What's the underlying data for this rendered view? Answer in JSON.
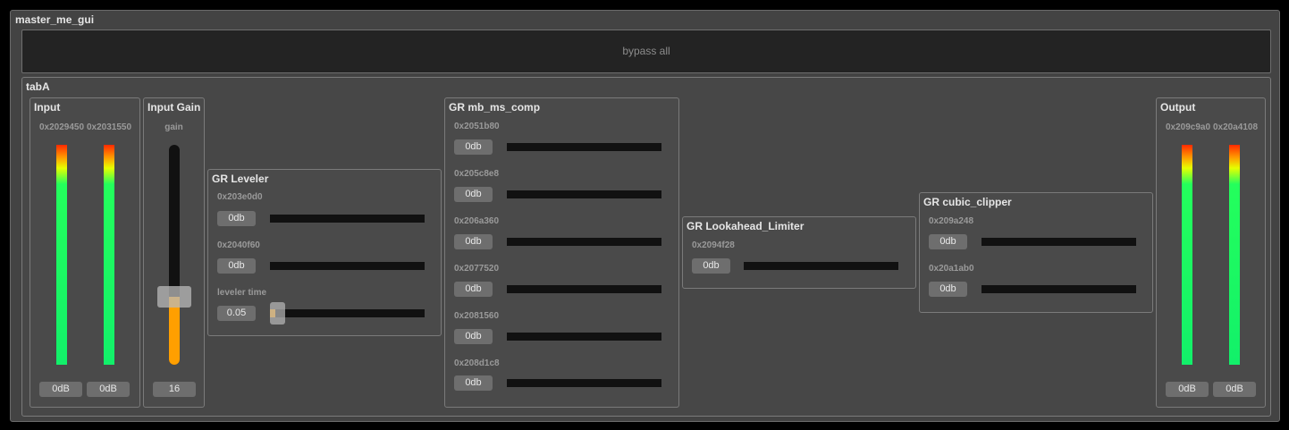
{
  "window": {
    "title": "master_me_gui",
    "bypass_label": "bypass all"
  },
  "tab": {
    "title": "tabA"
  },
  "input": {
    "title": "Input",
    "channels": [
      {
        "id": "0x2029450",
        "value": "0dB"
      },
      {
        "id": "0x2031550",
        "value": "0dB"
      }
    ]
  },
  "input_gain": {
    "title": "Input Gain",
    "label": "gain",
    "value": "16",
    "level": 0.31
  },
  "leveler": {
    "title": "GR Leveler",
    "meters": [
      {
        "id": "0x203e0d0",
        "value": "0db"
      },
      {
        "id": "0x2040f60",
        "value": "0db"
      }
    ],
    "time": {
      "label": "leveler time",
      "value": "0.05",
      "level": 0.03
    }
  },
  "mb_ms_comp": {
    "title": "GR mb_ms_comp",
    "meters": [
      {
        "id": "0x2051b80",
        "value": "0db"
      },
      {
        "id": "0x205c8e8",
        "value": "0db"
      },
      {
        "id": "0x206a360",
        "value": "0db"
      },
      {
        "id": "0x2077520",
        "value": "0db"
      },
      {
        "id": "0x2081560",
        "value": "0db"
      },
      {
        "id": "0x208d1c8",
        "value": "0db"
      }
    ]
  },
  "limiter": {
    "title": "GR Lookahead_Limiter",
    "meters": [
      {
        "id": "0x2094f28",
        "value": "0db"
      }
    ]
  },
  "cubic_clipper": {
    "title": "GR cubic_clipper",
    "meters": [
      {
        "id": "0x209a248",
        "value": "0db"
      },
      {
        "id": "0x20a1ab0",
        "value": "0db"
      }
    ]
  },
  "output": {
    "title": "Output",
    "channels": [
      {
        "id": "0x209c9a0",
        "value": "0dB"
      },
      {
        "id": "0x20a4108",
        "value": "0dB"
      }
    ]
  },
  "colors": {
    "panel": "#434343",
    "background": "#000000",
    "slider_fill": "#ff9f00",
    "meter_track": "#111111"
  }
}
